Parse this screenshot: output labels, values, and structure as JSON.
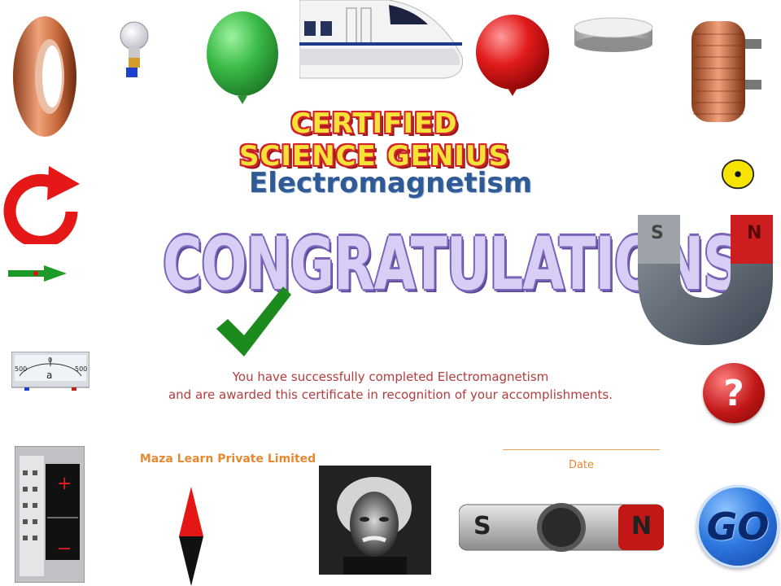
{
  "header": {
    "banner": "CERTIFIED SCIENCE GENIUS",
    "subject": "Electromagnetism",
    "congrats": "CONGRATULATIONS!"
  },
  "message": {
    "line1": "You have successfully completed Electromagnetism",
    "line2": "and are awarded this certificate in recognition of your accomplishments."
  },
  "footer": {
    "company": "Maza Learn Private Limited",
    "date_label": "Date"
  },
  "buttons": {
    "go_label": "GO",
    "help_label": "?"
  },
  "images": {
    "horseshoe_magnet": {
      "left_pole": "S",
      "right_pole": "N"
    },
    "bar_magnet": {
      "left_pole": "S",
      "right_pole": "N"
    },
    "meter": {
      "left_value": "500",
      "center_value": "0",
      "right_value": "500",
      "unit": "a"
    },
    "power_supply": {
      "plus": "+",
      "minus": "−"
    }
  },
  "colors": {
    "accent_red": "#d0222a",
    "subject_blue": "#2f5a96",
    "message_red": "#b43c3c",
    "company_orange": "#e58a33",
    "go_blue": "#2f78e0"
  }
}
